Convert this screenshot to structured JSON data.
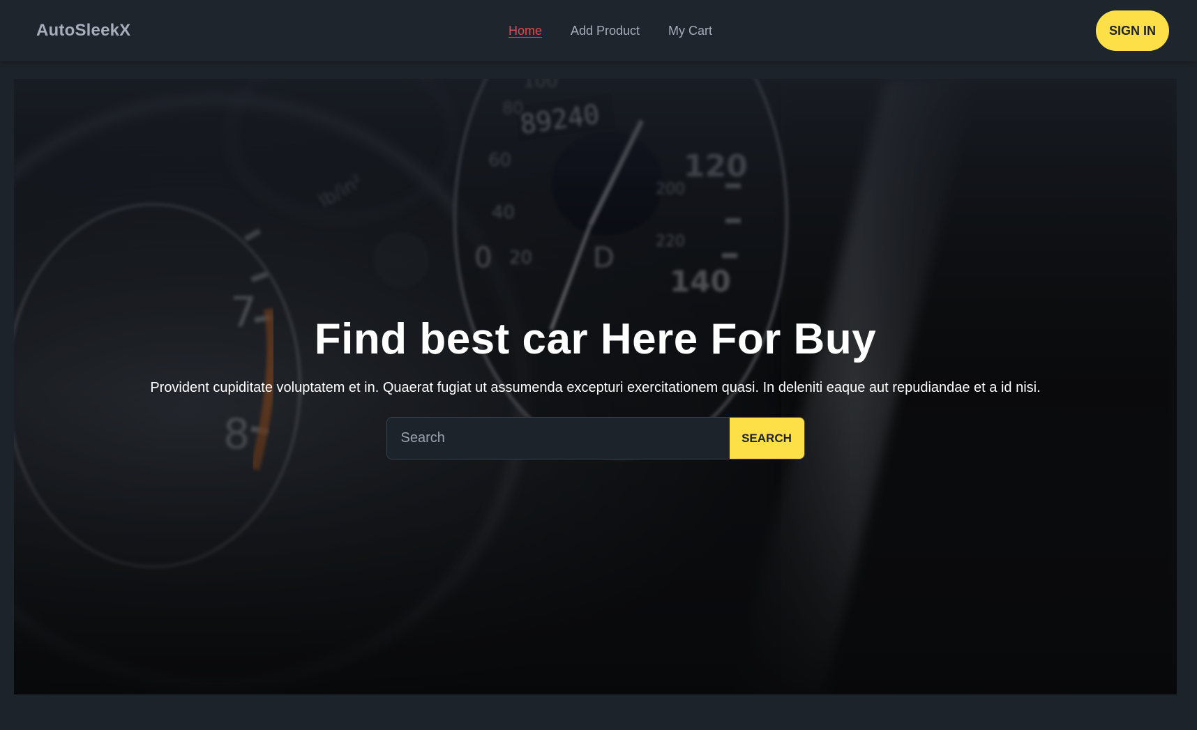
{
  "navbar": {
    "brand": "AutoSleekX",
    "links": [
      {
        "label": "Home",
        "active": true
      },
      {
        "label": "Add Product",
        "active": false
      },
      {
        "label": "My Cart",
        "active": false
      }
    ],
    "signin_label": "SIGN IN"
  },
  "hero": {
    "title": "Find best car Here For Buy",
    "subtitle": "Provident cupiditate voluptatem et in. Quaerat fugiat ut assumenda excepturi exercitationem quasi. In deleniti eaque aut repudiandae et a id nisi.",
    "search": {
      "placeholder": "Search",
      "button_label": "SEARCH"
    },
    "background": {
      "gauge_numbers": [
        "89240",
        "100",
        "80",
        "60",
        "40",
        "20",
        "0",
        "120",
        "140",
        "7",
        "8"
      ]
    }
  },
  "colors": {
    "accent": "#fde047",
    "active_link": "#e5484d",
    "page_bg": "#1d232a"
  }
}
